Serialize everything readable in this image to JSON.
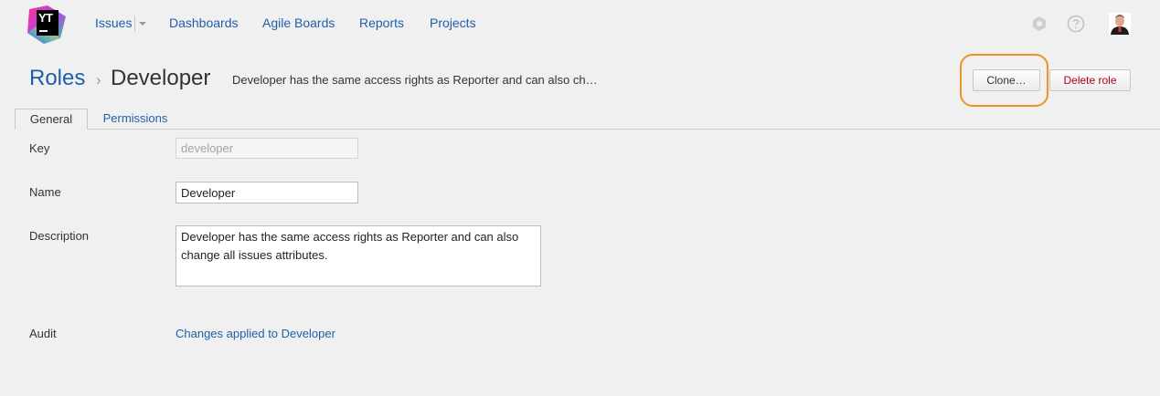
{
  "logo": {
    "text": "YT"
  },
  "nav": {
    "issues": "Issues",
    "dashboards": "Dashboards",
    "agile_boards": "Agile Boards",
    "reports": "Reports",
    "projects": "Projects"
  },
  "header": {
    "breadcrumb_root": "Roles",
    "breadcrumb_sep": "›",
    "title": "Developer",
    "description_preview": "Developer has the same access rights as Reporter and can also ch…"
  },
  "actions": {
    "clone_label": "Clone…",
    "delete_label": "Delete role"
  },
  "tabs": [
    {
      "label": "General",
      "active": true
    },
    {
      "label": "Permissions",
      "active": false
    }
  ],
  "form": {
    "key_label": "Key",
    "key_value": "developer",
    "name_label": "Name",
    "name_value": "Developer",
    "description_label": "Description",
    "description_value": "Developer has the same access rights as Reporter and can also change all issues attributes.",
    "audit_label": "Audit",
    "audit_link": "Changes applied to Developer"
  },
  "colors": {
    "link": "#1f5fa8",
    "danger": "#b00020",
    "highlight": "#f0922b",
    "background": "#f0f0f0"
  },
  "icons": [
    "youtrack-logo-icon",
    "settings-hexagon-icon",
    "help-icon",
    "avatar"
  ]
}
